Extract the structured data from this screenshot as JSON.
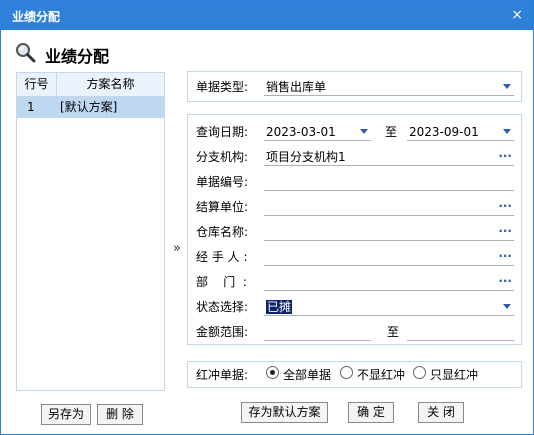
{
  "window": {
    "title": "业绩分配",
    "close_glyph": "×"
  },
  "header": {
    "title": "业绩分配",
    "icon": "search-icon"
  },
  "scheme_list": {
    "columns": [
      "行号",
      "方案名称"
    ],
    "rows": [
      {
        "no": "1",
        "name": "[默认方案]"
      }
    ]
  },
  "expand_glyph": "»",
  "doc_type": {
    "label": "单据类型:",
    "value": "销售出库单"
  },
  "filters": {
    "date": {
      "label": "查询日期:",
      "from": "2023-03-01",
      "to_label": "至",
      "to": "2023-09-01"
    },
    "branch": {
      "label": "分支机构:",
      "value": "项目分支机构1"
    },
    "doc_no": {
      "label": "单据编号:",
      "value": ""
    },
    "settle_unit": {
      "label": "结算单位:",
      "value": ""
    },
    "warehouse": {
      "label": "仓库名称:",
      "value": ""
    },
    "handler": {
      "label": "经 手 人 :",
      "value": ""
    },
    "dept": {
      "label": "部    门  :",
      "value": ""
    },
    "status": {
      "label": "状态选择:",
      "value": "已摊"
    },
    "amount": {
      "label": "金额范围:",
      "to_label": "至",
      "from": "",
      "to": ""
    }
  },
  "red_flush": {
    "label": "红冲单据:",
    "options": [
      "全部单据",
      "不显红冲",
      "只显红冲"
    ],
    "selected": 0
  },
  "buttons": {
    "save_as": "另存为",
    "delete": "删 除",
    "save_default": "存为默认方案",
    "ok": "确 定",
    "close": "关 闭"
  },
  "colors": {
    "titlebar": "#2f80d8",
    "border": "#c6d7ea",
    "selected_row": "#bfd8f2"
  }
}
